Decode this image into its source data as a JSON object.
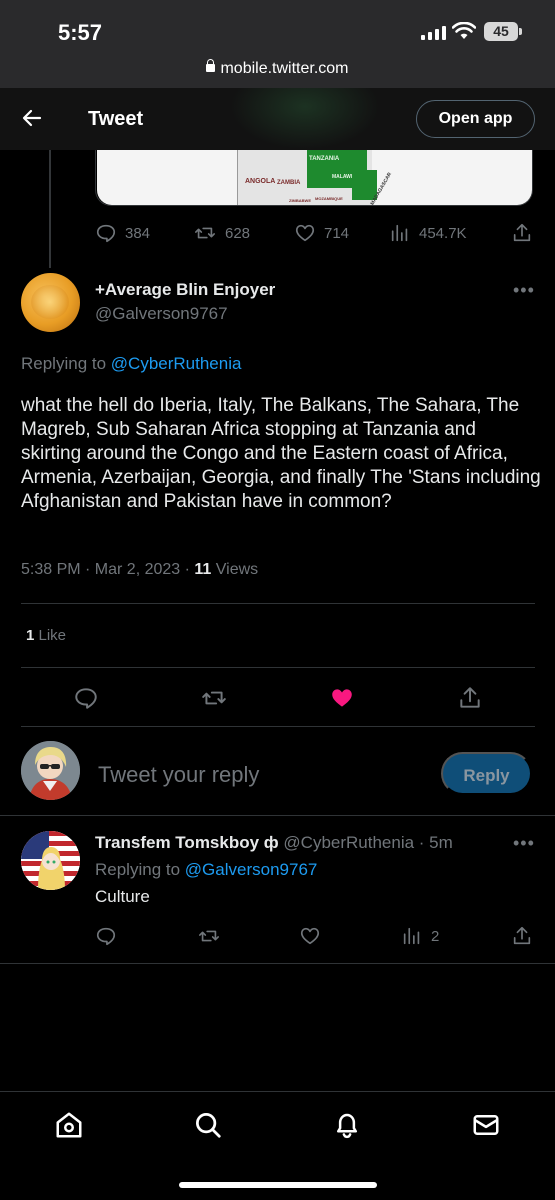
{
  "status_bar": {
    "time": "5:57",
    "battery": "45",
    "url": "mobile.twitter.com"
  },
  "header": {
    "title": "Tweet",
    "open_app": "Open app"
  },
  "previous_tweet": {
    "map_labels": [
      "ANGOLA",
      "ZAMBIA",
      "TANZANIA",
      "MALAWI",
      "ZIMBABWE",
      "MOZAMBIQUE",
      "MADAGASCAR"
    ],
    "replies": "384",
    "retweets": "628",
    "likes": "714",
    "views": "454.7K"
  },
  "main_tweet": {
    "display_name": "+Average Blin Enjoyer",
    "handle": "@Galverson9767",
    "replying_prefix": "Replying to",
    "replying_to": "@CyberRuthenia",
    "text": "what the hell do Iberia, Italy, The Balkans, The Sahara, The Magreb, Sub Saharan Africa stopping at Tanzania and skirting around the Congo and the Eastern coast of Africa, Armenia, Azerbaijan, Georgia, and finally The 'Stans including Afghanistan and Pakistan have in common?",
    "timestamp": "5:38 PM · Mar 2, 2023 · ",
    "views_count": "11",
    "views_label": " Views",
    "likes_count": "1",
    "likes_label": " Like",
    "liked_color": "#f91880"
  },
  "composer": {
    "placeholder": "Tweet your reply",
    "button": "Reply"
  },
  "reply_tweet": {
    "display_name": "Transfem Tomskboy ф",
    "handle": "@CyberRuthenia",
    "age": " · 5m",
    "replying_prefix": "Replying to",
    "replying_to": "@Galverson9767",
    "text": "Culture",
    "views": "2"
  },
  "accent_color": "#1d9bf0"
}
